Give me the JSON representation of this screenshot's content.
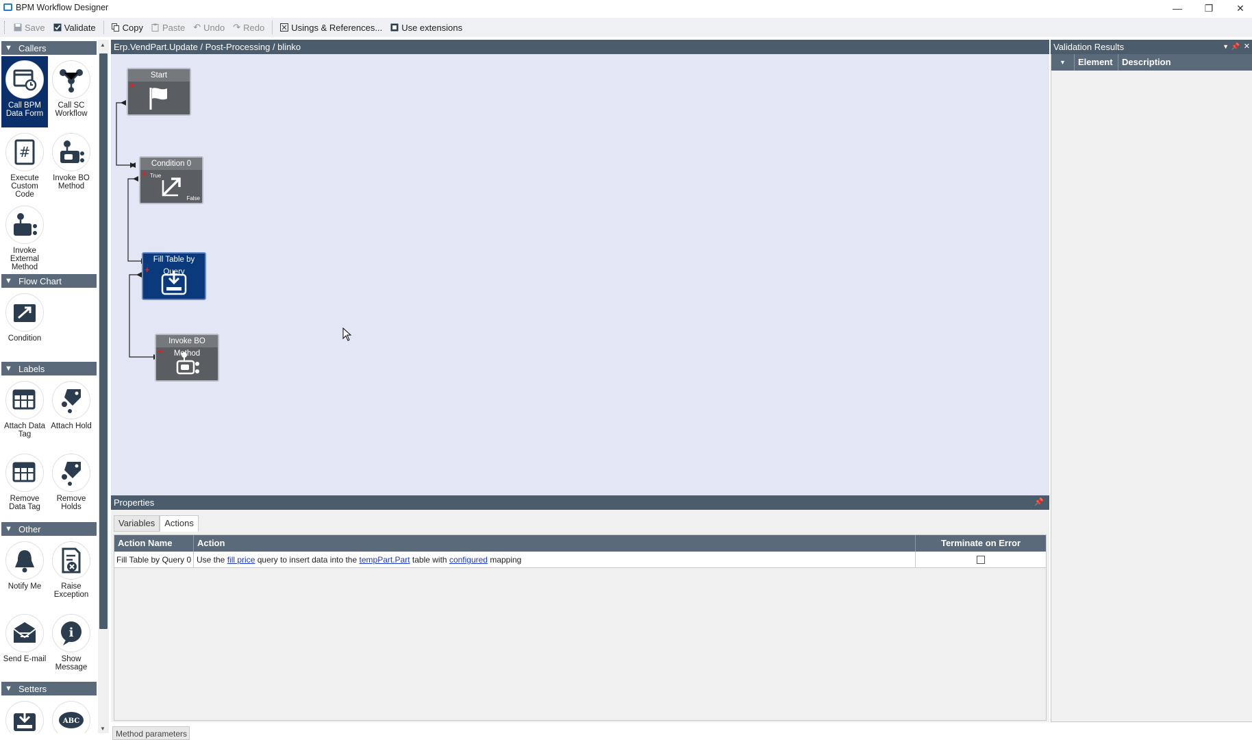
{
  "window": {
    "title": "BPM Workflow Designer",
    "controls": {
      "minimize": "—",
      "restore": "❐",
      "close": "✕"
    }
  },
  "toolbar": {
    "save": "Save",
    "validate": "Validate",
    "copy": "Copy",
    "paste": "Paste",
    "undo": "Undo",
    "redo": "Redo",
    "usings": "Usings & References...",
    "extensions": "Use extensions"
  },
  "palette": {
    "groups": {
      "callers": "Callers",
      "flowchart": "Flow Chart",
      "labels": "Labels",
      "other": "Other",
      "setters": "Setters"
    },
    "tools": {
      "call_bpm": "Call BPM Data Form",
      "call_sc": "Call SC Workflow",
      "exec_code": "Execute Custom Code",
      "invoke_bo": "Invoke BO Method",
      "invoke_ext": "Invoke External Method",
      "condition": "Condition",
      "attach_tag": "Attach Data Tag",
      "attach_hold": "Attach Hold",
      "remove_tag": "Remove Data Tag",
      "remove_holds": "Remove Holds",
      "notify": "Notify Me",
      "raise": "Raise Exception",
      "send_email": "Send E-mail",
      "show_msg": "Show Message",
      "abc_text": "ABC"
    }
  },
  "canvas": {
    "breadcrumb": "Erp.VendPart.Update / Post-Processing / blinko",
    "nodes": {
      "start": "Start",
      "condition": "Condition 0",
      "condition_true": "True",
      "condition_false": "False",
      "fill": "Fill Table by Query",
      "invoke": "Invoke BO Method"
    }
  },
  "properties": {
    "title": "Properties",
    "tabs": {
      "variables": "Variables",
      "actions": "Actions"
    },
    "columns": {
      "name": "Action Name",
      "action": "Action",
      "terminate": "Terminate on Error"
    },
    "row": {
      "name": "Fill Table by Query 0",
      "t1": "Use the",
      "l1": "fill price",
      "t2": "query to insert data into the",
      "l2": "tempPart.Part",
      "t3": "table with",
      "l3": "configured",
      "t4": "mapping",
      "terminate": false
    },
    "bottom_tab": "Method parameters"
  },
  "validation": {
    "title": "Validation Results",
    "columns": {
      "element": "Element",
      "description": "Description"
    }
  },
  "colors": {
    "header": "#4b5c6c",
    "canvas_bg": "#e2e6f5",
    "selected": "#0a3a7b",
    "node": "#5a5d62",
    "link": "#1a38c8"
  }
}
